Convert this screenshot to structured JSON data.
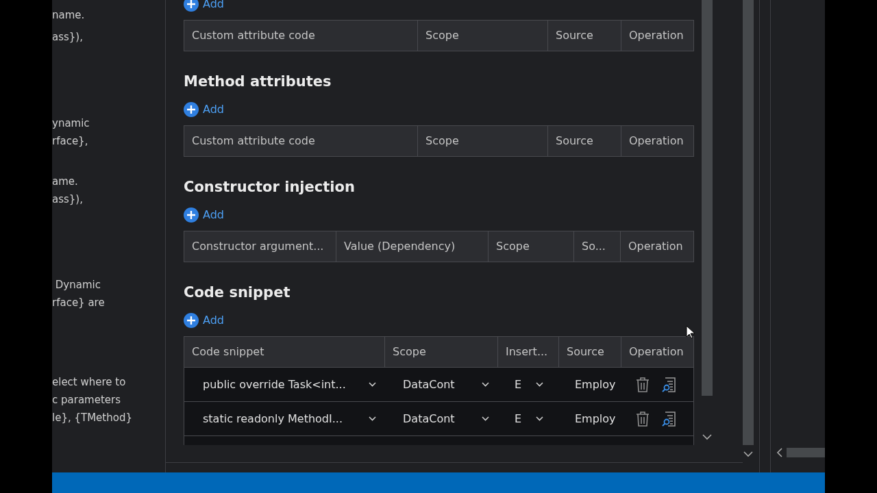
{
  "side_text": [
    [
      "name.",
      "ass}),"
    ],
    [
      "ynamic",
      "rface},"
    ],
    [
      "ame.",
      "ass}),"
    ],
    [
      " Dynamic",
      "rface} are"
    ],
    [
      "elect where to",
      "c parameters",
      "le}, {TMethod}"
    ]
  ],
  "sections": [
    {
      "add": "Add",
      "columns": [
        "Custom attribute code",
        "Scope",
        "Source",
        "Operation"
      ]
    },
    {
      "title": "Method attributes",
      "add": "Add",
      "columns": [
        "Custom attribute code",
        "Scope",
        "Source",
        "Operation"
      ]
    },
    {
      "title": "Constructor injection",
      "add": "Add",
      "columns": [
        "Constructor argument...",
        "Value (Dependency)",
        "Scope",
        "So...",
        "Operation"
      ]
    },
    {
      "title": "Code snippet",
      "add": "Add",
      "columns": [
        "Code snippet",
        "Scope",
        "Insert...",
        "Source",
        "Operation"
      ],
      "rows": [
        {
          "snippet": "public override Task<int...",
          "scope": "DataCont",
          "insert": "E",
          "source": "Employ"
        },
        {
          "snippet": "static readonly MethodI...",
          "scope": "DataCont",
          "insert": "E",
          "source": "Employ"
        }
      ]
    }
  ]
}
